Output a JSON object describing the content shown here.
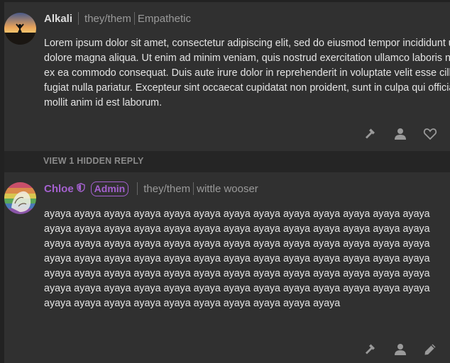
{
  "comments": [
    {
      "username": "Alkali",
      "pronouns": "they/them",
      "flair": "Empathetic",
      "body_lines": [
        "Lorem ipsum dolor sit amet, consectetur adipiscing elit, sed do eiusmod tempor incididunt ut labore et",
        "dolore magna aliqua. Ut enim ad minim veniam, quis nostrud exercitation ullamco laboris nisi ut aliquip",
        "ex ea commodo consequat. Duis aute irure dolor in reprehenderit in voluptate velit esse cillum dolore eu",
        "fugiat nulla pariatur. Excepteur sint occaecat cupidatat non proident, sunt in culpa qui officia deserunt",
        "mollit anim id est laborum."
      ],
      "actions": [
        "hammer-icon",
        "user-icon",
        "heart-icon"
      ]
    },
    {
      "username": "Chloe",
      "badge": "Admin",
      "pronouns": "they/them",
      "flair": "wittle wooser",
      "body": "ayaya ayaya ayaya ayaya ayaya ayaya ayaya ayaya ayaya ayaya ayaya ayaya ayaya ayaya ayaya ayaya ayaya ayaya ayaya ayaya ayaya ayaya ayaya ayaya ayaya ayaya ayaya ayaya ayaya ayaya ayaya ayaya ayaya ayaya ayaya ayaya ayaya ayaya ayaya ayaya ayaya ayaya ayaya ayaya ayaya ayaya ayaya ayaya ayaya ayaya ayaya ayaya ayaya ayaya ayaya ayaya ayaya ayaya ayaya ayaya ayaya ayaya ayaya ayaya ayaya ayaya ayaya ayaya ayaya ayaya ayaya ayaya ayaya ayaya ayaya ayaya ayaya ayaya ayaya ayaya ayaya ayaya ayaya ayaya ayaya ayaya ayaya ayaya",
      "actions": [
        "hammer-icon",
        "user-icon",
        "pencil-icon"
      ]
    }
  ],
  "hidden_replies_label": "VIEW 1 HIDDEN REPLY",
  "colors": {
    "admin_accent": "#a461cf",
    "background": "#303030",
    "text": "#e4e4e4",
    "meta": "#9a9a9a"
  }
}
